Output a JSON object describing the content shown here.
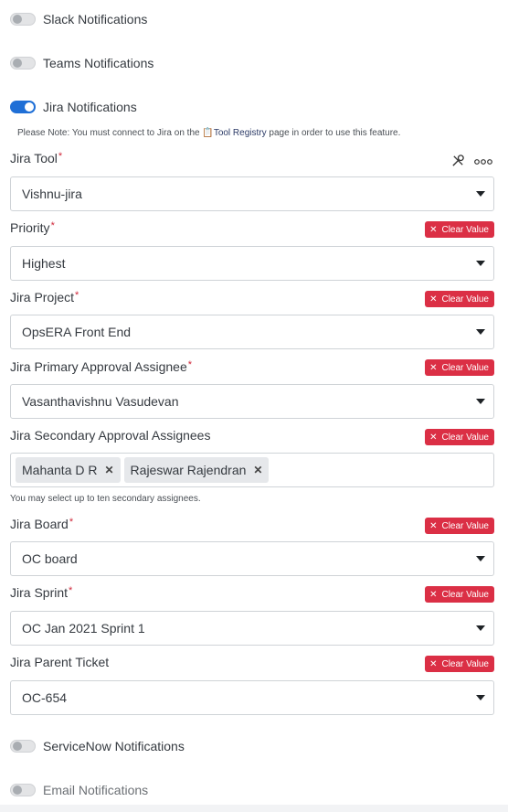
{
  "toggles": {
    "slack": {
      "label": "Slack Notifications",
      "on": false
    },
    "teams": {
      "label": "Teams Notifications",
      "on": false
    },
    "jira": {
      "label": "Jira Notifications",
      "on": true
    },
    "servicenow": {
      "label": "ServiceNow Notifications",
      "on": false
    },
    "email": {
      "label": "Email Notifications",
      "on": false
    }
  },
  "note": {
    "prefix": "Please Note: You must connect to Jira on the",
    "link": "Tool Registry",
    "suffix": "page in order to use this feature."
  },
  "clear_label": "Clear Value",
  "fields": {
    "jira_tool": {
      "label": "Jira Tool",
      "value": "Vishnu-jira"
    },
    "priority": {
      "label": "Priority",
      "value": "Highest"
    },
    "project": {
      "label": "Jira Project",
      "value": "OpsERA Front End"
    },
    "primary_assignee": {
      "label": "Jira Primary Approval Assignee",
      "value": "Vasanthavishnu Vasudevan"
    },
    "secondary_assignees": {
      "label": "Jira Secondary Approval Assignees",
      "chips": [
        "Mahanta D R",
        "Rajeswar Rajendran"
      ],
      "help": "You may select up to ten secondary assignees."
    },
    "board": {
      "label": "Jira Board",
      "value": "OC board"
    },
    "sprint": {
      "label": "Jira Sprint",
      "value": "OC Jan 2021 Sprint 1"
    },
    "parent_ticket": {
      "label": "Jira Parent Ticket",
      "value": "OC-654"
    }
  },
  "required_mark": "*",
  "icons": {
    "tool_link": "wrench-screwdriver-icon",
    "more": "ellipsis-icon",
    "clipboard": "clipboard-icon",
    "clear": "x-icon",
    "chip_remove": "x-icon",
    "caret": "caret-down-icon"
  },
  "colors": {
    "accent": "#1f6fd6",
    "danger": "#db2f45",
    "required": "#d0283a"
  }
}
